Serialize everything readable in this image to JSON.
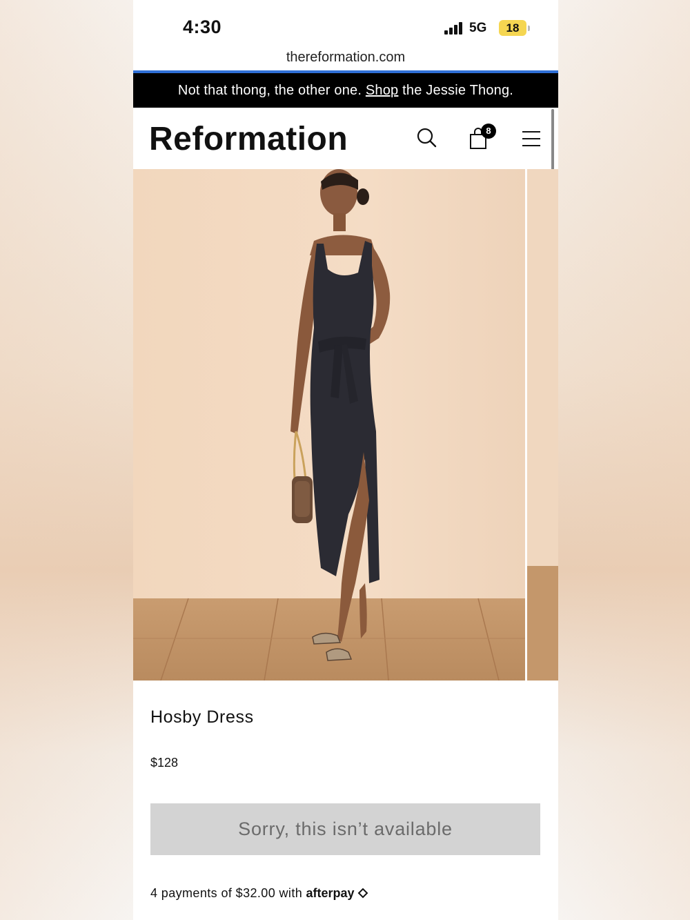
{
  "status_bar": {
    "time": "4:30",
    "network": "5G",
    "battery": "18"
  },
  "browser": {
    "url": "thereformation.com"
  },
  "promo": {
    "text_before": "Not that thong, the other one. ",
    "link": "Shop",
    "text_after": " the Jessie Thong."
  },
  "header": {
    "logo": "Reformation",
    "bag_count": "8",
    "icons": [
      "search-icon",
      "bag-icon",
      "menu-icon"
    ]
  },
  "product": {
    "name": "Hosby Dress",
    "price": "$128",
    "button_label": "Sorry, this isn’t available",
    "payment_text": "4 payments of $32.00 with ",
    "payment_brand": "afterpay"
  },
  "colors": {
    "accent_line": "#2f6fd6",
    "banner_bg": "#000000",
    "button_bg": "#d3d3d3",
    "battery": "#f5d651"
  }
}
